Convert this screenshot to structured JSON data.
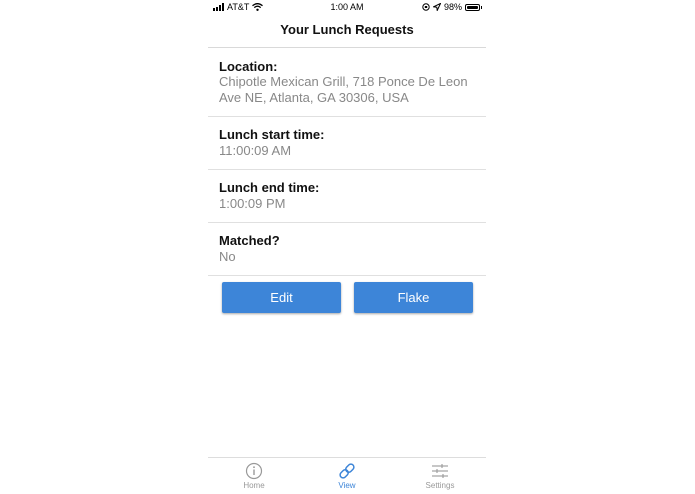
{
  "status_bar": {
    "carrier": "AT&T",
    "time": "1:00 AM",
    "battery": "98%",
    "battery_level": 0.98
  },
  "nav": {
    "title": "Your Lunch Requests"
  },
  "details": [
    {
      "label": "Location:",
      "value": "Chipotle Mexican Grill, 718 Ponce De Leon Ave NE, Atlanta, GA 30306, USA"
    },
    {
      "label": "Lunch start time:",
      "value": "11:00:09 AM"
    },
    {
      "label": "Lunch end time:",
      "value": "1:00:09 PM"
    },
    {
      "label": "Matched?",
      "value": "No"
    }
  ],
  "buttons": {
    "edit": "Edit",
    "flake": "Flake"
  },
  "tabs": [
    {
      "label": "Home",
      "icon": "info-icon"
    },
    {
      "label": "View",
      "icon": "link-icon",
      "active": true
    },
    {
      "label": "Settings",
      "icon": "sliders-icon"
    }
  ],
  "colors": {
    "accent": "#3d85d8",
    "inactive": "#999999"
  }
}
